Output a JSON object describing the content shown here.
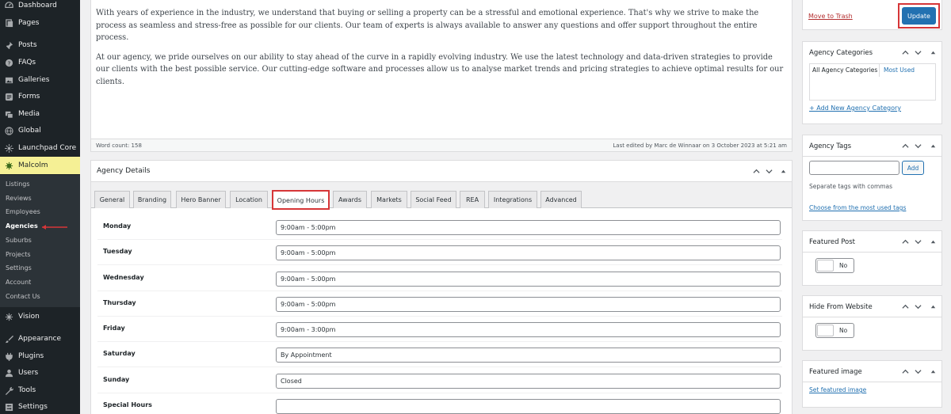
{
  "sidebar": {
    "items": [
      {
        "label": "Dashboard",
        "icon": "dashboard-icon"
      },
      {
        "label": "Pages",
        "icon": "pages-icon"
      },
      {
        "label": "Posts",
        "icon": "pin-icon"
      },
      {
        "label": "FAQs",
        "icon": "question-icon"
      },
      {
        "label": "Galleries",
        "icon": "gallery-icon"
      },
      {
        "label": "Forms",
        "icon": "forms-icon"
      },
      {
        "label": "Media",
        "icon": "media-icon"
      },
      {
        "label": "Global",
        "icon": "globe-icon"
      },
      {
        "label": "Launchpad Core",
        "icon": "launchpad-icon"
      },
      {
        "label": "Malcolm",
        "icon": "malcolm-icon"
      },
      {
        "label": "Vision",
        "icon": "vision-icon"
      },
      {
        "label": "Appearance",
        "icon": "paintbrush-icon"
      },
      {
        "label": "Plugins",
        "icon": "plug-icon"
      },
      {
        "label": "Users",
        "icon": "user-icon"
      },
      {
        "label": "Tools",
        "icon": "wrench-icon"
      },
      {
        "label": "Settings",
        "icon": "settings-icon"
      }
    ],
    "submenu": [
      "Listings",
      "Reviews",
      "Employees",
      "Agencies",
      "Suburbs",
      "Projects",
      "Settings",
      "Account",
      "Contact Us"
    ],
    "current_submenu": "Agencies"
  },
  "editor": {
    "paragraphs": [
      "With years of experience in the industry, we understand that buying or selling a property can be a stressful and emotional experience. That's why we strive to make the process as seamless and stress-free as possible for our clients. Our team of experts is always available to answer any questions and offer support throughout the entire process.",
      "At our agency, we pride ourselves on our ability to stay ahead of the curve in a rapidly evolving industry. We use the latest technology and data-driven strategies to provide our clients with the best possible service. Our cutting-edge software and processes allow us to analyse market trends and pricing strategies to achieve optimal results for our clients."
    ],
    "word_count": "Word count: 158",
    "last_edited": "Last edited by Marc de Winnaar on 3 October 2023 at 5:21 am"
  },
  "agency_details": {
    "title": "Agency Details",
    "tabs": [
      "General",
      "Branding",
      "Hero Banner",
      "Location",
      "Opening Hours",
      "Awards",
      "Markets",
      "Social Feed",
      "REA",
      "Integrations",
      "Advanced"
    ],
    "active_tab": "Opening Hours",
    "hours": [
      {
        "day": "Monday",
        "value": "9:00am - 5:00pm"
      },
      {
        "day": "Tuesday",
        "value": "9:00am - 5:00pm"
      },
      {
        "day": "Wednesday",
        "value": "9:00am - 5:00pm"
      },
      {
        "day": "Thursday",
        "value": "9:00am - 5:00pm"
      },
      {
        "day": "Friday",
        "value": "9:00am - 3:00pm"
      },
      {
        "day": "Saturday",
        "value": "By Appointment"
      },
      {
        "day": "Sunday",
        "value": "Closed"
      },
      {
        "day": "Special Hours",
        "value": ""
      }
    ]
  },
  "publish": {
    "move_to_trash": "Move to Trash",
    "update": "Update"
  },
  "categories": {
    "title": "Agency Categories",
    "tab_all": "All Agency Categories",
    "tab_used": "Most Used",
    "add_new": "+ Add New Agency Category"
  },
  "tags": {
    "title": "Agency Tags",
    "add": "Add",
    "hint": "Separate tags with commas",
    "choose": "Choose from the most used tags"
  },
  "featured_post": {
    "title": "Featured Post",
    "toggle": "No"
  },
  "hide_from_website": {
    "title": "Hide From Website",
    "toggle": "No"
  },
  "featured_image": {
    "title": "Featured image",
    "set": "Set featured image"
  },
  "colors": {
    "sidebar_bg": "#1d2327",
    "active_menu": "#f5f095",
    "accent": "#2271b1",
    "highlight": "#d63638"
  }
}
